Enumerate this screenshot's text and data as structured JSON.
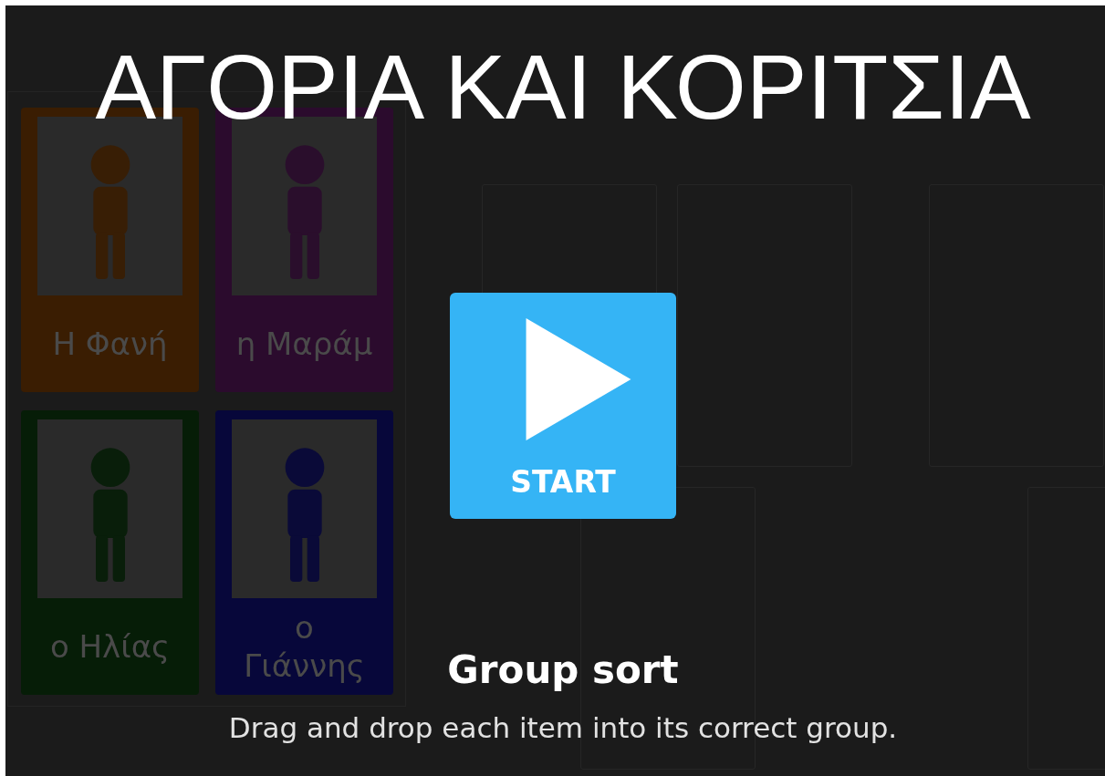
{
  "cards": [
    {
      "label": "Η Φανή",
      "color": "#3a1d02"
    },
    {
      "label": "η Μαράμ",
      "color": "#2b0b2d"
    },
    {
      "label": "ο Ηλίας",
      "color": "#061d07"
    },
    {
      "label": "ο Γιάννης",
      "color": "#07073a"
    }
  ],
  "overlay": {
    "title": "ΑΓΟΡΙΑ ΚΑΙ ΚΟΡΙΤΣΙΑ",
    "start_button": "START",
    "game_type": "Group sort",
    "instructions": "Drag and drop each item into its correct group."
  }
}
